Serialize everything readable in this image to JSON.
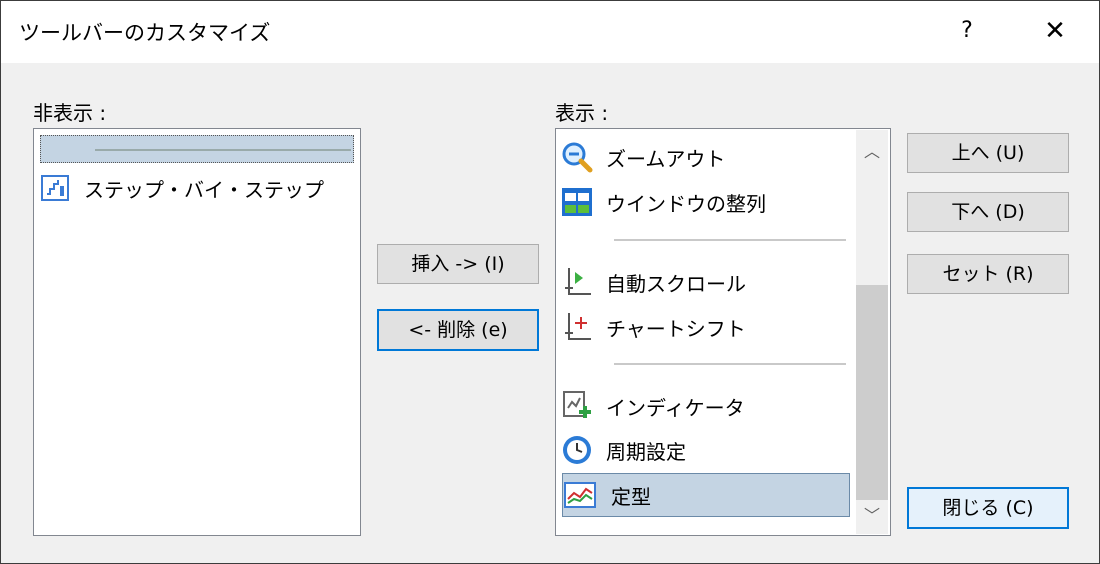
{
  "window": {
    "title": "ツールバーのカスタマイズ",
    "help": "?",
    "close": "✕"
  },
  "left": {
    "label": "非表示 :",
    "items": [
      {
        "type": "separator",
        "selected": true
      },
      {
        "label": "ステップ・バイ・ステップ",
        "icon": "step-by-step-icon"
      }
    ]
  },
  "middle": {
    "insert": "挿入 -> (I)",
    "remove": "<- 削除 (e)"
  },
  "right": {
    "label": "表示 :",
    "items": [
      {
        "label": "ズームアウト",
        "icon": "zoom-out-icon"
      },
      {
        "label": "ウインドウの整列",
        "icon": "tile-windows-icon"
      },
      {
        "type": "separator"
      },
      {
        "label": "自動スクロール",
        "icon": "auto-scroll-icon"
      },
      {
        "label": "チャートシフト",
        "icon": "chart-shift-icon"
      },
      {
        "type": "separator"
      },
      {
        "label": "インディケータ",
        "icon": "indicator-add-icon"
      },
      {
        "label": "周期設定",
        "icon": "clock-icon"
      },
      {
        "label": "定型",
        "icon": "template-icon",
        "selected": true
      }
    ]
  },
  "buttons": {
    "up": "上へ (U)",
    "down": "下へ (D)",
    "reset": "セット (R)",
    "close": "閉じる (C)"
  },
  "colors": {
    "selection": "#c4d4e3",
    "focus": "#0078d7"
  }
}
